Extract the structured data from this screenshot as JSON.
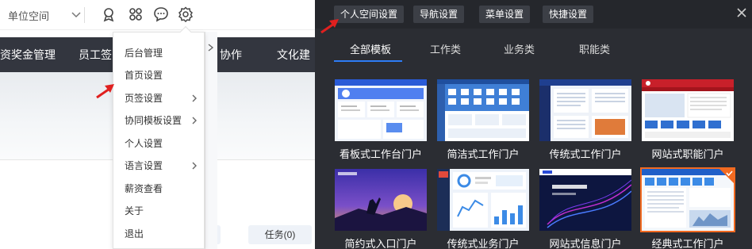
{
  "left": {
    "space_select": "单位空间",
    "nav_items": [
      "资奖金管理",
      "员工签",
      "协作",
      "文化建"
    ],
    "task_btn_prev": ")",
    "task_btn": "任务(0)",
    "menu": [
      {
        "label": "后台管理",
        "has_sub": false
      },
      {
        "label": "首页设置",
        "has_sub": false
      },
      {
        "label": "页签设置",
        "has_sub": true
      },
      {
        "label": "协同模板设置",
        "has_sub": true
      },
      {
        "label": "个人设置",
        "has_sub": false
      },
      {
        "label": "语言设置",
        "has_sub": true
      },
      {
        "label": "薪资查看",
        "has_sub": false
      },
      {
        "label": "关于",
        "has_sub": false
      },
      {
        "label": "退出",
        "has_sub": false
      }
    ]
  },
  "right": {
    "buttons": [
      "个人空间设置",
      "导航设置",
      "菜单设置",
      "快捷设置"
    ],
    "tabs": [
      "全部模板",
      "工作类",
      "业务类",
      "职能类"
    ],
    "active_tab": "全部模板",
    "templates": [
      {
        "label": "看板式工作台门户",
        "style": "kanban",
        "selected": false
      },
      {
        "label": "简洁式工作门户",
        "style": "simple",
        "selected": false
      },
      {
        "label": "传统式工作门户",
        "style": "traditional",
        "selected": false
      },
      {
        "label": "网站式职能门户",
        "style": "website",
        "selected": false
      },
      {
        "label": "简约式入口门户",
        "style": "minimal",
        "selected": false
      },
      {
        "label": "传统式业务门户",
        "style": "business",
        "selected": false
      },
      {
        "label": "网站式信息门户",
        "style": "info",
        "selected": false
      },
      {
        "label": "经典式工作门户",
        "style": "classic",
        "selected": true
      }
    ]
  },
  "colors": {
    "accent_blue": "#2d7cf6",
    "selected_orange": "#f26a21",
    "dark_nav": "#33363f",
    "panel_bg": "#2b2d33",
    "arrow_red": "#e0201f"
  },
  "icons": [
    "chevron-down-icon",
    "medal-icon",
    "apps-icon",
    "chat-icon",
    "settings-icon",
    "close-icon",
    "chevron-right-icon",
    "check-icon"
  ]
}
